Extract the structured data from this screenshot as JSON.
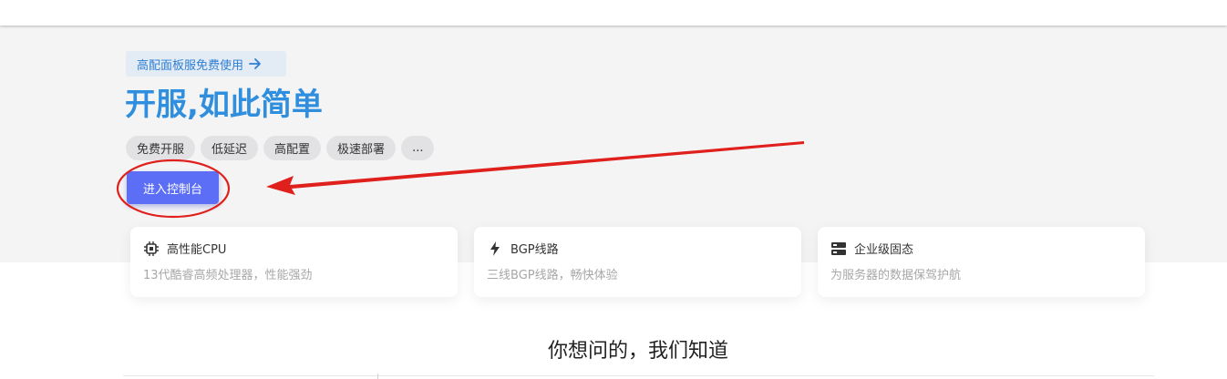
{
  "hero": {
    "promo_label": "高配面板服免费使用",
    "headline": "开服,如此简单",
    "tags": [
      "免费开服",
      "低延迟",
      "高配置",
      "极速部署",
      "..."
    ],
    "cta_label": "进入控制台"
  },
  "features": [
    {
      "icon": "cpu-icon",
      "title": "高性能CPU",
      "desc": "13代酷睿高频处理器，性能强劲"
    },
    {
      "icon": "lightning-icon",
      "title": "BGP线路",
      "desc": "三线BGP线路，畅快体验"
    },
    {
      "icon": "server-icon",
      "title": "企业级固态",
      "desc": "为服务器的数据保驾护航"
    }
  ],
  "faq": {
    "title": "你想问的，我们知道"
  },
  "colors": {
    "accent": "#2f8fde",
    "button": "#5b6ef5",
    "annotation": "#e0201c"
  }
}
